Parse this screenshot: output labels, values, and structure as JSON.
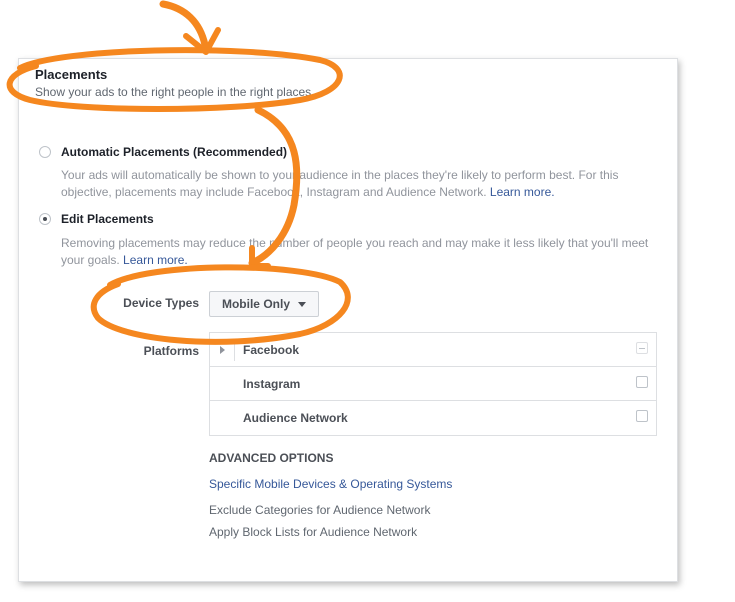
{
  "section": {
    "title": "Placements",
    "subtitle": "Show your ads to the right people in the right places."
  },
  "automatic": {
    "label": "Automatic Placements (Recommended)",
    "selected": false,
    "desc_text": "Your ads will automatically be shown to your audience in the places they're likely to perform best. For this objective, placements may include Facebook, Instagram and Audience Network.",
    "learn_more": "Learn more."
  },
  "edit": {
    "label": "Edit Placements",
    "selected": true,
    "desc_text": "Removing placements may reduce the number of people you reach and may make it less likely that you'll meet your goals.",
    "learn_more": "Learn more."
  },
  "device_types": {
    "label": "Device Types",
    "value": "Mobile Only"
  },
  "platforms": {
    "label": "Platforms",
    "items": [
      {
        "name": "Facebook",
        "state": "mixed"
      },
      {
        "name": "Instagram",
        "state": "unchecked"
      },
      {
        "name": "Audience Network",
        "state": "unchecked"
      }
    ]
  },
  "advanced": {
    "title": "ADVANCED OPTIONS",
    "links": [
      "Specific Mobile Devices & Operating Systems",
      "Exclude Categories for Audience Network",
      "Apply Block Lists for Audience Network"
    ]
  },
  "colors": {
    "annotation": "#f5871f",
    "link": "#365899"
  }
}
